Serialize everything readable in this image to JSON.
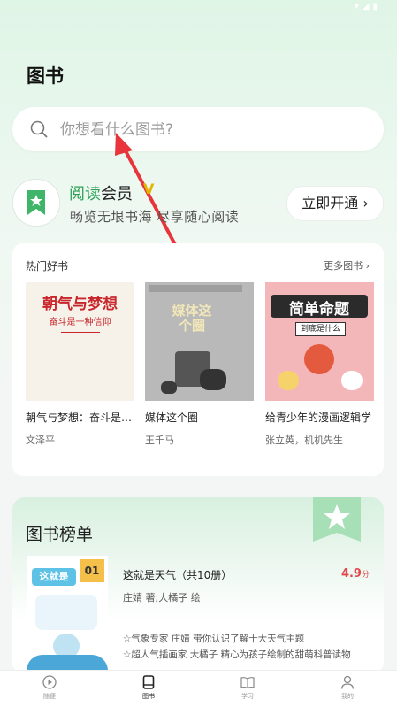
{
  "page": {
    "title": "图书"
  },
  "search": {
    "placeholder": "你想看什么图书?"
  },
  "member": {
    "title_green": "阅读",
    "title_rest": "会员",
    "vip_mark": "V",
    "subtitle": "畅览无垠书海 尽享随心阅读",
    "open_button": "立即开通 ›"
  },
  "hot_books": {
    "title": "热门好书",
    "more": "更多图书 ›",
    "books": [
      {
        "name": "朝气与梦想：奋斗是一种信仰",
        "author": "文泽平",
        "cover_title": "朝气与梦想",
        "cover_sub": "奋斗是一种信仰"
      },
      {
        "name": "媒体这个圈",
        "author": "王千马",
        "cover_title": "媒体这个圈"
      },
      {
        "name": "给青少年的漫画逻辑学",
        "author": "张立英，机机先生",
        "cover_title": "简单命题",
        "cover_sub": "到底是什么"
      }
    ]
  },
  "ranking": {
    "title": "图书榜单",
    "book": {
      "title": "这就是天气（共10册）",
      "score": "4.9",
      "score_unit": "分",
      "author": "庄婧 著;大橘子 绘",
      "desc_line1": "☆气象专家 庄婧 带你认识了解十大天气主题",
      "desc_line2": "☆超人气插画家 大橘子 精心为孩子绘制的甜萌科普读物",
      "cover_text": "这就是",
      "cover_badge": "01"
    }
  },
  "tabbar": {
    "tabs": [
      {
        "label": "随便"
      },
      {
        "label": "图书"
      },
      {
        "label": "学习"
      },
      {
        "label": "我的"
      }
    ]
  },
  "colors": {
    "accent_green": "#2fa257",
    "score_red": "#e0484a",
    "vip_gold": "#e2b600"
  }
}
